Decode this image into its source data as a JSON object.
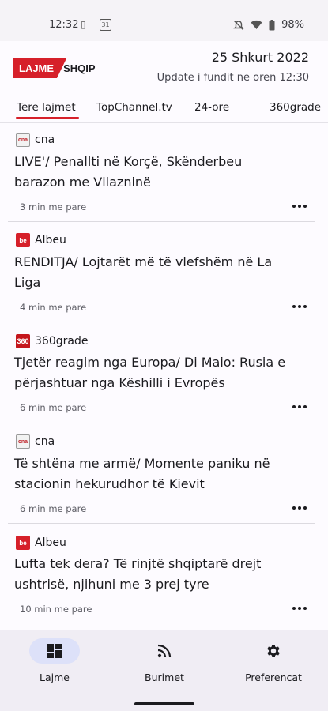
{
  "status": {
    "time": "12:32",
    "calendar": "31",
    "battery": "98%"
  },
  "header": {
    "logo_red": "LAJME",
    "logo_black": "SHQIP",
    "date": "25 Shkurt 2022",
    "update": "Update i fundit ne oren 12:30"
  },
  "tabs": [
    "Tere lajmet",
    "TopChannel.tv",
    "24-ore",
    "360grade"
  ],
  "articles": [
    {
      "source": "cna",
      "icon": "cna-logo-icon",
      "title_line1": "LIVE'/ Penallti në Korçë, Skënderbeu",
      "title_line2": "barazon me Vllazninë",
      "time": "3 min me pare"
    },
    {
      "source": "Albeu",
      "icon": "albeu-logo-icon",
      "title_line1": "RENDITJA/ Lojtarët më të vlefshëm në La",
      "title_line2": "Liga",
      "time": "4 min me pare"
    },
    {
      "source": "360grade",
      "icon": "360grade-logo-icon",
      "title_line1": "Tjetër reagim nga Europa/ Di Maio: Rusia e",
      "title_line2": "përjashtuar nga Këshilli i Evropës",
      "time": "6 min me pare"
    },
    {
      "source": "cna",
      "icon": "cna-logo-icon",
      "title_line1": "Të shtëna me armë/ Momente paniku në",
      "title_line2": "stacionin hekurudhor të Kievit",
      "time": "6 min me pare"
    },
    {
      "source": "Albeu",
      "icon": "albeu-logo-icon",
      "title_line1": "Lufta tek dera? Të rinjtë shqiptarë drejt",
      "title_line2": "ushtrisë, njihuni me 3 prej tyre",
      "time": "10 min me pare"
    }
  ],
  "nav": [
    {
      "label": "Lajme",
      "icon": "grid-icon"
    },
    {
      "label": "Burimet",
      "icon": "rss-icon"
    },
    {
      "label": "Preferencat",
      "icon": "gear-icon"
    }
  ],
  "colors": {
    "accent": "#d6202a",
    "nav_active": "#dde1f9",
    "nav_bg": "#f0edf4"
  }
}
